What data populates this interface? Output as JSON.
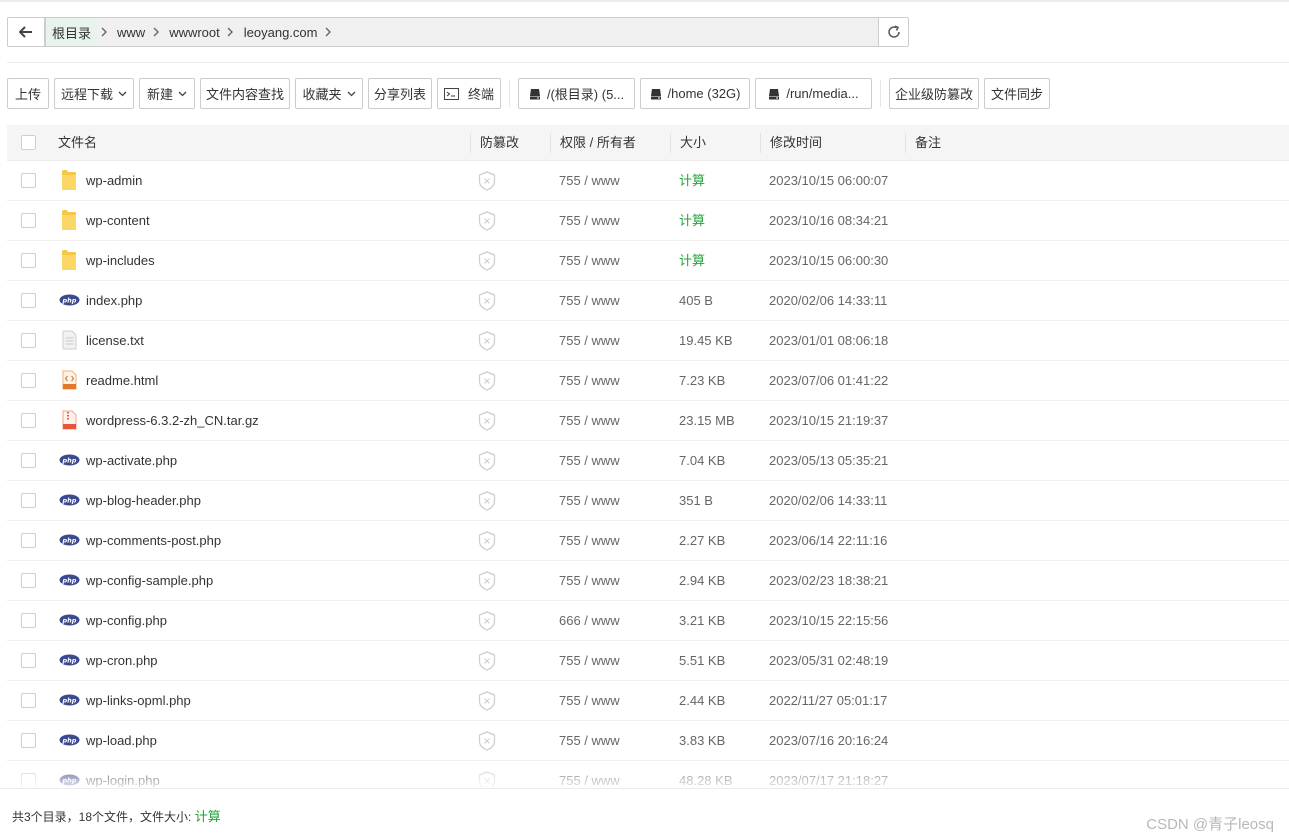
{
  "path": {
    "root_label": "根目录",
    "segments": [
      "www",
      "wwwroot",
      "leoyang.com"
    ]
  },
  "toolbar": {
    "upload": "上传",
    "remote_download": "远程下载",
    "new": "新建",
    "content_search": "文件内容查找",
    "favorites": "收藏夹",
    "share_list": "分享列表",
    "terminal": "终端",
    "disks": [
      "/(根目录) (5...",
      "/home (32G)",
      "/run/media..."
    ],
    "enterprise_tamper": "企业级防篡改",
    "file_sync": "文件同步"
  },
  "table": {
    "headers": {
      "name": "文件名",
      "tamper": "防篡改",
      "perm": "权限 / 所有者",
      "size": "大小",
      "mtime": "修改时间",
      "note": "备注"
    },
    "rows": [
      {
        "type": "folder",
        "name": "wp-admin",
        "perm": "755 / www",
        "size": "计算",
        "mtime": "2023/10/15 06:00:07"
      },
      {
        "type": "folder",
        "name": "wp-content",
        "perm": "755 / www",
        "size": "计算",
        "mtime": "2023/10/16 08:34:21"
      },
      {
        "type": "folder",
        "name": "wp-includes",
        "perm": "755 / www",
        "size": "计算",
        "mtime": "2023/10/15 06:00:30"
      },
      {
        "type": "php",
        "name": "index.php",
        "perm": "755 / www",
        "size": "405 B",
        "mtime": "2020/02/06 14:33:11"
      },
      {
        "type": "txt",
        "name": "license.txt",
        "perm": "755 / www",
        "size": "19.45 KB",
        "mtime": "2023/01/01 08:06:18"
      },
      {
        "type": "html",
        "name": "readme.html",
        "perm": "755 / www",
        "size": "7.23 KB",
        "mtime": "2023/07/06 01:41:22"
      },
      {
        "type": "archive",
        "name": "wordpress-6.3.2-zh_CN.tar.gz",
        "perm": "755 / www",
        "size": "23.15 MB",
        "mtime": "2023/10/15 21:19:37"
      },
      {
        "type": "php",
        "name": "wp-activate.php",
        "perm": "755 / www",
        "size": "7.04 KB",
        "mtime": "2023/05/13 05:35:21"
      },
      {
        "type": "php",
        "name": "wp-blog-header.php",
        "perm": "755 / www",
        "size": "351 B",
        "mtime": "2020/02/06 14:33:11"
      },
      {
        "type": "php",
        "name": "wp-comments-post.php",
        "perm": "755 / www",
        "size": "2.27 KB",
        "mtime": "2023/06/14 22:11:16"
      },
      {
        "type": "php",
        "name": "wp-config-sample.php",
        "perm": "755 / www",
        "size": "2.94 KB",
        "mtime": "2023/02/23 18:38:21"
      },
      {
        "type": "php",
        "name": "wp-config.php",
        "perm": "666 / www",
        "size": "3.21 KB",
        "mtime": "2023/10/15 22:15:56"
      },
      {
        "type": "php",
        "name": "wp-cron.php",
        "perm": "755 / www",
        "size": "5.51 KB",
        "mtime": "2023/05/31 02:48:19"
      },
      {
        "type": "php",
        "name": "wp-links-opml.php",
        "perm": "755 / www",
        "size": "2.44 KB",
        "mtime": "2022/11/27 05:01:17"
      },
      {
        "type": "php",
        "name": "wp-load.php",
        "perm": "755 / www",
        "size": "3.83 KB",
        "mtime": "2023/07/16 20:16:24"
      },
      {
        "type": "php",
        "name": "wp-login.php",
        "perm": "755 / www",
        "size": "48.28 KB",
        "mtime": "2023/07/17 21:18:27"
      }
    ]
  },
  "footer": {
    "summary": "共3个目录，18个文件，文件大小:",
    "calc_label": "计算"
  },
  "watermark": "CSDN @青子leosq",
  "colors": {
    "accent_green": "#20a53a",
    "php_icon": "#3d4a8f",
    "folder": "#f6c847"
  }
}
